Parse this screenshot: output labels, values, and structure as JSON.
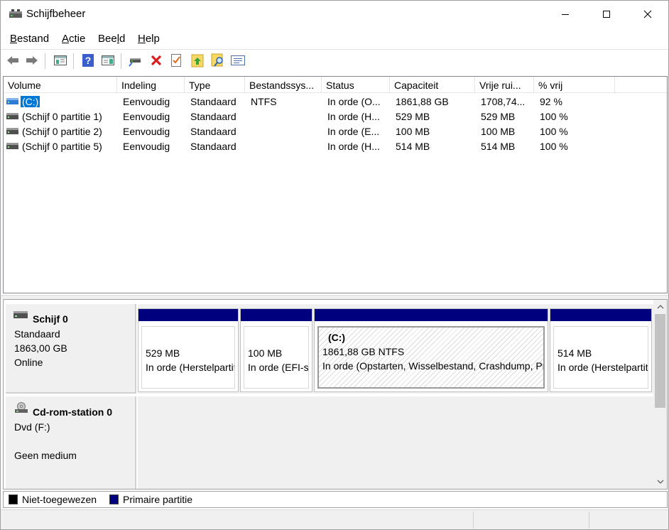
{
  "window": {
    "title": "Schijfbeheer"
  },
  "menu": {
    "items": [
      {
        "label": "Bestand",
        "key": "B",
        "rest": "estand"
      },
      {
        "label": "Actie",
        "key": "A",
        "rest": "ctie"
      },
      {
        "label": "Beeld",
        "pre": "Bee",
        "key": "l",
        "post": "d"
      },
      {
        "label": "Help",
        "key": "H",
        "rest": "elp"
      }
    ]
  },
  "toolbar": {
    "icons": [
      "back-arrow-icon",
      "forward-arrow-icon",
      "console-tree-icon",
      "help-icon",
      "action-pane-icon",
      "connect-disk-icon",
      "delete-icon",
      "properties-icon",
      "export-list-icon",
      "search-icon",
      "settings-icon"
    ]
  },
  "volume_list": {
    "columns": [
      "Volume",
      "Indeling",
      "Type",
      "Bestandssys...",
      "Status",
      "Capaciteit",
      "Vrije rui...",
      "% vrij"
    ],
    "rows": [
      {
        "volume": "(C:)",
        "indeling": "Eenvoudig",
        "type": "Standaard",
        "fs": "NTFS",
        "status": "In orde (O...",
        "capaciteit": "1861,88 GB",
        "vrij": "1708,74...",
        "pct": "92 %"
      },
      {
        "volume": "(Schijf 0 partitie 1)",
        "indeling": "Eenvoudig",
        "type": "Standaard",
        "fs": "",
        "status": "In orde (H...",
        "capaciteit": "529 MB",
        "vrij": "529 MB",
        "pct": "100 %"
      },
      {
        "volume": "(Schijf 0 partitie 2)",
        "indeling": "Eenvoudig",
        "type": "Standaard",
        "fs": "",
        "status": "In orde (E...",
        "capaciteit": "100 MB",
        "vrij": "100 MB",
        "pct": "100 %"
      },
      {
        "volume": "(Schijf 0 partitie 5)",
        "indeling": "Eenvoudig",
        "type": "Standaard",
        "fs": "",
        "status": "In orde (H...",
        "capaciteit": "514 MB",
        "vrij": "514 MB",
        "pct": "100 %"
      }
    ]
  },
  "disks": [
    {
      "name": "Schijf 0",
      "line1": "Standaard",
      "line2": "1863,00 GB",
      "line3": "Online"
    },
    {
      "name": "Cd-rom-station 0",
      "line1": "Dvd (F:)",
      "line2": "",
      "line3": "Geen medium"
    }
  ],
  "partitions": [
    {
      "label": "",
      "size": "529 MB",
      "status": "In orde (Herstelpartitie)"
    },
    {
      "label": "",
      "size": "100 MB",
      "status": "In orde (EFI-systeempartitie)"
    },
    {
      "label": "(C:)",
      "size": "1861,88 GB NTFS",
      "status": "In orde (Opstarten, Wisselbestand, Crashdump, Primaire partitie)"
    },
    {
      "label": "",
      "size": "514 MB",
      "status": "In orde (Herstelpartitie)"
    }
  ],
  "legend": [
    {
      "label": "Niet-toegewezen",
      "color": "#000000"
    },
    {
      "label": "Primaire partitie",
      "color": "#00007f"
    }
  ]
}
